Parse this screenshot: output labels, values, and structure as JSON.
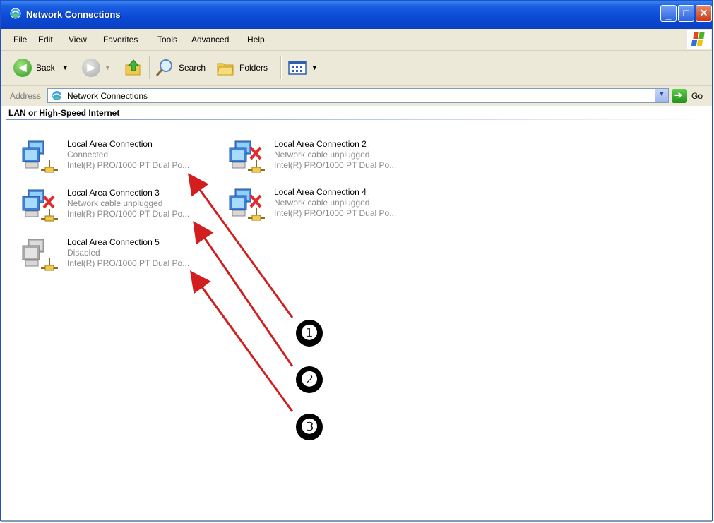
{
  "window": {
    "title": "Network Connections",
    "title_color": "#0a48d6"
  },
  "menu": [
    {
      "label": "File",
      "underline": "F"
    },
    {
      "label": "Edit",
      "underline": "E"
    },
    {
      "label": "View",
      "underline": "V"
    },
    {
      "label": "Favorites",
      "underline": "a"
    },
    {
      "label": "Tools",
      "underline": "T"
    },
    {
      "label": "Advanced",
      "underline": "n"
    },
    {
      "label": "Help",
      "underline": "H"
    }
  ],
  "toolbar": {
    "back_label": "Back",
    "search_label": "Search",
    "folders_label": "Folders"
  },
  "address": {
    "label": "Address",
    "value": "Network Connections",
    "go_label": "Go"
  },
  "group": {
    "header": "LAN or High-Speed Internet"
  },
  "connections": [
    {
      "name": "Local Area Connection",
      "status": "Connected",
      "device": "Intel(R) PRO/1000 PT Dual Po...",
      "state": "connected"
    },
    {
      "name": "Local Area Connection 2",
      "status": "Network cable unplugged",
      "device": "Intel(R) PRO/1000 PT Dual Po...",
      "state": "unplugged"
    },
    {
      "name": "Local Area Connection 3",
      "status": "Network cable unplugged",
      "device": "Intel(R) PRO/1000 PT Dual Po...",
      "state": "unplugged"
    },
    {
      "name": "Local Area Connection 4",
      "status": "Network cable unplugged",
      "device": "Intel(R) PRO/1000 PT Dual Po...",
      "state": "unplugged"
    },
    {
      "name": "Local Area Connection 5",
      "status": "Disabled",
      "device": "Intel(R) PRO/1000 PT Dual Po...",
      "state": "disabled"
    }
  ],
  "callouts": [
    {
      "label": "❶"
    },
    {
      "label": "❷"
    },
    {
      "label": "❸"
    }
  ],
  "colors": {
    "arrow": "#d21e1e",
    "status_text": "#8a8a8a",
    "titlebar": "#0a48d6"
  }
}
